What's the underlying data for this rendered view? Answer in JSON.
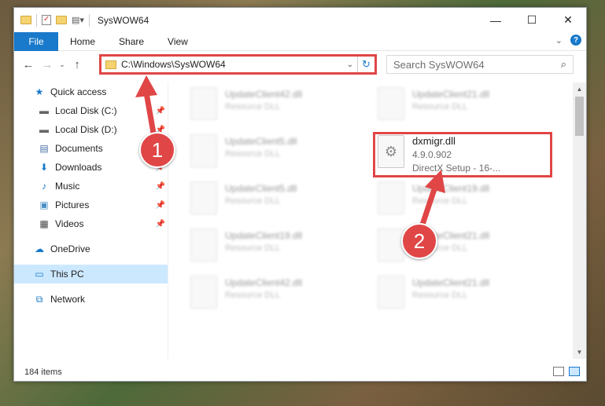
{
  "window": {
    "title": "SysWOW64",
    "controls": {
      "minimize": "—",
      "maximize": "☐",
      "close": "✕"
    }
  },
  "ribbon": {
    "tabs": [
      "File",
      "Home",
      "Share",
      "View"
    ],
    "help": "?"
  },
  "address": {
    "path": "C:\\Windows\\SysWOW64"
  },
  "search": {
    "placeholder": "Search SysWOW64"
  },
  "sidebar": {
    "items": [
      {
        "label": "Quick access",
        "icon": "star-icon",
        "pinned": false
      },
      {
        "label": "Local Disk (C:)",
        "icon": "drive-icon",
        "pinned": true
      },
      {
        "label": "Local Disk (D:)",
        "icon": "drive-icon",
        "pinned": true
      },
      {
        "label": "Documents",
        "icon": "documents-icon",
        "pinned": true
      },
      {
        "label": "Downloads",
        "icon": "download-icon",
        "pinned": true
      },
      {
        "label": "Music",
        "icon": "music-icon",
        "pinned": true
      },
      {
        "label": "Pictures",
        "icon": "pictures-icon",
        "pinned": true
      },
      {
        "label": "Videos",
        "icon": "videos-icon",
        "pinned": true
      },
      {
        "label": "OneDrive",
        "icon": "cloud-icon",
        "pinned": false
      },
      {
        "label": "This PC",
        "icon": "computer-icon",
        "pinned": false,
        "selected": true
      },
      {
        "label": "Network",
        "icon": "network-icon",
        "pinned": false
      }
    ]
  },
  "files": [
    {
      "name": "UpdateClient42.dll",
      "type": "Resource DLL"
    },
    {
      "name": "UpdateClient21.dll",
      "type": "Resource DLL"
    },
    {
      "name": "UpdateClient5.dll",
      "type": "Resource DLL"
    },
    {
      "name": "UpdateClient5.dll",
      "type": "Resource DLL"
    },
    {
      "name": "UpdateClient19.dll",
      "type": "Resource DLL"
    },
    {
      "name": "UpdateClient19.dll",
      "type": "Resource DLL"
    },
    {
      "name": "UpdateClient21.dll",
      "type": "Resource DLL"
    },
    {
      "name": "UpdateClient42.dll",
      "type": "Resource DLL"
    },
    {
      "name": "UpdateClient21.dll",
      "type": "Resource DLL"
    }
  ],
  "highlighted_file": {
    "name": "dxmigr.dll",
    "version": "4.9.0.902",
    "description": "DirectX Setup - 16-..."
  },
  "status": {
    "item_count": "184 items"
  },
  "annotations": {
    "badge1": "1",
    "badge2": "2",
    "color": "#e04646"
  }
}
